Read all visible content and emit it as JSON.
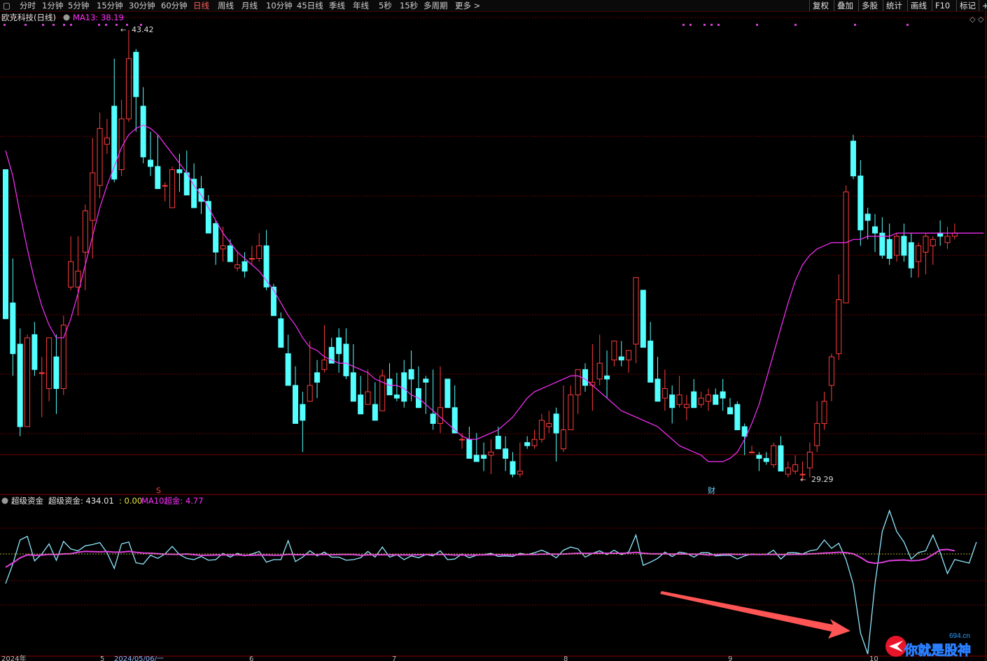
{
  "toolbar": {
    "periods": [
      "分时",
      "1分钟",
      "5分钟",
      "15分钟",
      "30分钟",
      "60分钟",
      "日线",
      "周线",
      "月线",
      "10分钟",
      "45日线",
      "季线",
      "年线",
      "5秒",
      "15秒",
      "多周期",
      "更多 >"
    ],
    "active_index": 6,
    "right_buttons": [
      "复权",
      "叠加",
      "多股",
      "统计",
      "画线",
      "F10",
      "标记",
      "+自"
    ]
  },
  "main_panel": {
    "title": "欧克科技(日线)",
    "ma_label": "MA13: 38.19",
    "high_label": "43.42",
    "low_label": "29.29",
    "marker_s": "S",
    "marker_cai": "财"
  },
  "indicator_panel": {
    "name": "超级资金",
    "value_label": "超级资金: 434.01",
    "zero_label": ": 0.00",
    "ma_label": "MA10超金: 4.77"
  },
  "date_axis": {
    "labels": [
      "2024年",
      "5",
      "2024/05/06/一",
      "6",
      "7",
      "8",
      "9",
      "10"
    ]
  },
  "watermark": {
    "text": "你就是股神",
    "site": "694.cn"
  },
  "colors": {
    "up": "#ff3c3c",
    "down": "#54ffff",
    "ma": "#ff30ff",
    "indicator": "#8fe8ff",
    "indicator_ma": "#e040e0",
    "grid": "#6e0000",
    "arrow": "#ff5555"
  },
  "chart_data": {
    "type": "candlestick",
    "price_range": [
      29.29,
      43.42
    ],
    "ma_period": 13,
    "ohlc": [
      [
        39.0,
        39.0,
        34.5,
        34.3
      ],
      [
        34.8,
        36.2,
        32.5,
        33.2
      ],
      [
        33.5,
        34.0,
        30.6,
        30.9
      ],
      [
        30.9,
        33.8,
        30.9,
        33.7
      ],
      [
        33.8,
        34.2,
        32.5,
        32.7
      ],
      [
        32.6,
        33.1,
        31.2,
        32.6
      ],
      [
        32.1,
        33.7,
        31.7,
        33.7
      ],
      [
        33.1,
        33.8,
        31.3,
        32.1
      ],
      [
        32.1,
        34.4,
        31.9,
        34.1
      ],
      [
        35.3,
        36.9,
        35.2,
        36.1
      ],
      [
        35.3,
        36.9,
        34.4,
        35.8
      ],
      [
        36.4,
        37.9,
        35.2,
        37.7
      ],
      [
        37.4,
        40.0,
        36.2,
        38.9
      ],
      [
        38.5,
        40.8,
        38.1,
        40.3
      ],
      [
        39.8,
        40.6,
        39.5,
        40.0
      ],
      [
        41.0,
        42.5,
        38.6,
        38.7
      ],
      [
        39.0,
        41.2,
        38.8,
        40.6
      ],
      [
        40.6,
        43.4,
        40.5,
        42.5
      ],
      [
        42.7,
        42.8,
        40.2,
        41.3
      ],
      [
        41.0,
        41.6,
        39.2,
        39.4
      ],
      [
        39.3,
        40.2,
        38.8,
        39.1
      ],
      [
        39.1,
        40.1,
        38.6,
        38.4
      ],
      [
        38.5,
        38.6,
        38.0,
        38.5
      ],
      [
        37.8,
        39.1,
        37.8,
        39.0
      ],
      [
        39.0,
        39.5,
        38.3,
        38.9
      ],
      [
        38.9,
        39.6,
        38.3,
        38.2
      ],
      [
        38.7,
        39.2,
        38.0,
        37.8
      ],
      [
        38.4,
        38.8,
        37.6,
        38.0
      ],
      [
        38.0,
        38.2,
        37.2,
        37.0
      ],
      [
        37.3,
        37.4,
        36.0,
        36.4
      ],
      [
        36.5,
        37.2,
        36.1,
        36.6
      ],
      [
        36.6,
        36.8,
        36.1,
        36.1
      ],
      [
        35.9,
        36.4,
        35.8,
        36.0
      ],
      [
        36.1,
        36.4,
        35.6,
        35.8
      ],
      [
        36.2,
        36.6,
        36.0,
        36.2
      ],
      [
        36.2,
        37.0,
        36.1,
        36.6
      ],
      [
        36.6,
        37.1,
        35.2,
        35.3
      ],
      [
        35.3,
        35.4,
        34.7,
        34.4
      ],
      [
        34.3,
        34.5,
        33.4,
        33.4
      ],
      [
        33.2,
        33.8,
        32.2,
        32.2
      ],
      [
        32.2,
        32.8,
        31.1,
        31.0
      ],
      [
        31.6,
        32.0,
        30.1,
        31.1
      ],
      [
        31.7,
        33.6,
        31.8,
        32.2
      ],
      [
        32.6,
        33.0,
        31.8,
        32.3
      ],
      [
        32.7,
        34.1,
        32.6,
        33.0
      ],
      [
        33.4,
        33.7,
        32.9,
        32.9
      ],
      [
        33.7,
        34.0,
        32.6,
        33.2
      ],
      [
        33.5,
        34.0,
        32.4,
        32.5
      ],
      [
        32.6,
        33.5,
        32.2,
        31.7
      ],
      [
        31.9,
        32.5,
        31.4,
        31.3
      ],
      [
        31.6,
        32.7,
        31.6,
        32.0
      ],
      [
        31.6,
        32.3,
        31.1,
        31.1
      ],
      [
        31.4,
        32.7,
        31.4,
        32.5
      ],
      [
        32.4,
        32.9,
        32.0,
        31.9
      ],
      [
        31.9,
        32.6,
        31.7,
        31.8
      ],
      [
        32.6,
        33.0,
        31.5,
        31.7
      ],
      [
        32.7,
        33.3,
        31.7,
        32.4
      ],
      [
        32.1,
        32.8,
        31.7,
        31.5
      ],
      [
        32.4,
        32.5,
        31.3,
        32.3
      ],
      [
        31.3,
        32.7,
        30.8,
        31.0
      ],
      [
        31.0,
        32.8,
        30.7,
        31.5
      ],
      [
        32.4,
        32.4,
        31.5,
        31.5
      ],
      [
        31.5,
        32.2,
        31.0,
        30.7
      ],
      [
        30.5,
        30.7,
        30.2,
        30.5
      ],
      [
        30.5,
        30.9,
        30.1,
        29.9
      ],
      [
        30.0,
        30.7,
        29.9,
        29.8
      ],
      [
        30.0,
        30.4,
        29.5,
        29.9
      ],
      [
        30.0,
        30.5,
        29.4,
        30.1
      ],
      [
        30.6,
        30.9,
        30.3,
        30.2
      ],
      [
        30.2,
        30.6,
        29.5,
        29.9
      ],
      [
        29.8,
        30.1,
        29.3,
        29.4
      ],
      [
        29.4,
        30.4,
        29.3,
        29.5
      ],
      [
        30.4,
        30.6,
        30.2,
        30.3
      ],
      [
        30.3,
        30.8,
        30.2,
        30.5
      ],
      [
        30.5,
        31.3,
        30.4,
        31.1
      ],
      [
        30.9,
        31.4,
        30.7,
        31.0
      ],
      [
        31.3,
        31.5,
        29.8,
        30.7
      ],
      [
        30.2,
        32.2,
        30.1,
        30.8
      ],
      [
        30.8,
        32.2,
        30.8,
        31.9
      ],
      [
        31.9,
        32.6,
        31.3,
        32.7
      ],
      [
        32.7,
        32.9,
        32.0,
        32.2
      ],
      [
        32.2,
        33.5,
        31.4,
        32.3
      ],
      [
        32.4,
        33.8,
        32.2,
        32.9
      ],
      [
        32.5,
        33.3,
        31.8,
        32.4
      ],
      [
        33.0,
        33.2,
        32.8,
        33.6
      ],
      [
        33.1,
        33.6,
        32.8,
        33.0
      ],
      [
        33.0,
        33.3,
        32.6,
        33.3
      ],
      [
        33.5,
        34.0,
        32.9,
        35.6
      ],
      [
        35.2,
        35.2,
        33.4,
        33.4
      ],
      [
        33.6,
        34.2,
        32.3,
        32.3
      ],
      [
        32.4,
        33.1,
        32.1,
        31.7
      ],
      [
        31.8,
        32.7,
        31.4,
        32.1
      ],
      [
        31.9,
        32.2,
        31.0,
        31.5
      ],
      [
        31.6,
        32.5,
        31.5,
        31.9
      ],
      [
        31.5,
        31.9,
        31.1,
        31.6
      ],
      [
        32.0,
        32.4,
        31.6,
        31.5
      ],
      [
        31.6,
        32.0,
        31.5,
        31.8
      ],
      [
        31.7,
        32.1,
        31.4,
        31.9
      ],
      [
        31.9,
        32.1,
        31.7,
        31.6
      ],
      [
        32.0,
        32.4,
        31.4,
        31.8
      ],
      [
        31.5,
        31.8,
        31.4,
        31.3
      ],
      [
        31.6,
        31.7,
        31.0,
        30.8
      ],
      [
        30.9,
        31.0,
        30.0,
        30.6
      ],
      [
        30.1,
        30.3,
        30.1,
        30.1
      ],
      [
        30.0,
        30.1,
        29.5,
        29.9
      ],
      [
        29.9,
        30.1,
        29.7,
        29.8
      ],
      [
        29.7,
        30.4,
        29.6,
        30.3
      ],
      [
        30.3,
        30.6,
        29.5,
        29.5
      ],
      [
        29.4,
        29.8,
        29.3,
        29.6
      ],
      [
        29.5,
        30.0,
        29.4,
        29.7
      ],
      [
        29.4,
        29.8,
        29.2,
        29.4
      ],
      [
        29.6,
        30.4,
        29.3,
        30.1
      ],
      [
        30.3,
        31.7,
        30.1,
        31.0
      ],
      [
        31.0,
        32.0,
        30.8,
        31.7
      ],
      [
        32.2,
        33.2,
        31.7,
        33.1
      ],
      [
        33.2,
        35.7,
        33.0,
        34.9
      ],
      [
        34.8,
        38.5,
        34.8,
        38.3
      ],
      [
        39.9,
        40.1,
        38.7,
        38.8
      ],
      [
        38.8,
        39.3,
        36.6,
        37.1
      ],
      [
        37.6,
        37.8,
        36.8,
        37.4
      ],
      [
        37.2,
        37.6,
        36.4,
        37.0
      ],
      [
        37.0,
        37.5,
        36.2,
        36.3
      ],
      [
        36.8,
        37.3,
        36.0,
        36.2
      ],
      [
        36.3,
        37.0,
        36.1,
        36.9
      ],
      [
        36.9,
        37.3,
        36.1,
        36.3
      ],
      [
        36.7,
        37.0,
        35.6,
        35.9
      ],
      [
        36.1,
        36.7,
        35.6,
        36.6
      ],
      [
        36.4,
        37.0,
        35.7,
        36.9
      ],
      [
        36.6,
        36.9,
        36.0,
        36.8
      ],
      [
        37.0,
        37.4,
        36.6,
        36.9
      ],
      [
        36.7,
        37.2,
        36.5,
        36.9
      ],
      [
        36.9,
        37.3,
        36.8,
        37.0
      ]
    ],
    "ma13": [
      39.6,
      38.8,
      37.6,
      36.5,
      35.5,
      34.7,
      34.1,
      33.7,
      33.7,
      34.3,
      35.1,
      36.0,
      36.9,
      37.8,
      38.5,
      39.1,
      39.7,
      40.1,
      40.3,
      40.4,
      40.3,
      40.1,
      39.8,
      39.5,
      39.2,
      38.9,
      38.5,
      38.2,
      37.8,
      37.4,
      37.0,
      36.7,
      36.4,
      36.2,
      36.0,
      35.8,
      35.5,
      35.2,
      34.8,
      34.4,
      34.1,
      33.7,
      33.4,
      33.3,
      33.1,
      33.0,
      32.9,
      32.9,
      32.8,
      32.7,
      32.6,
      32.4,
      32.3,
      32.2,
      32.2,
      32.1,
      31.9,
      31.8,
      31.6,
      31.4,
      31.2,
      31.0,
      30.8,
      30.6,
      30.5,
      30.5,
      30.6,
      30.7,
      30.8,
      31.0,
      31.2,
      31.5,
      31.8,
      32.0,
      32.1,
      32.2,
      32.3,
      32.4,
      32.5,
      32.5,
      32.4,
      32.2,
      32.0,
      31.8,
      31.6,
      31.4,
      31.3,
      31.2,
      31.1,
      31.0,
      30.9,
      30.7,
      30.5,
      30.3,
      30.2,
      30.1,
      30.0,
      29.8,
      29.8,
      29.8,
      29.9,
      30.1,
      30.5,
      31.0,
      31.6,
      32.4,
      33.2,
      34.0,
      34.8,
      35.5,
      36.0,
      36.3,
      36.5,
      36.6,
      36.7,
      36.7,
      36.7,
      36.8,
      36.8,
      36.9,
      36.9,
      36.9,
      36.9,
      37.0,
      37.0,
      37.0,
      37.0,
      37.0,
      37.0,
      37.0,
      37.0,
      37.0,
      37.0,
      37.0,
      37.0,
      37.0
    ]
  }
}
